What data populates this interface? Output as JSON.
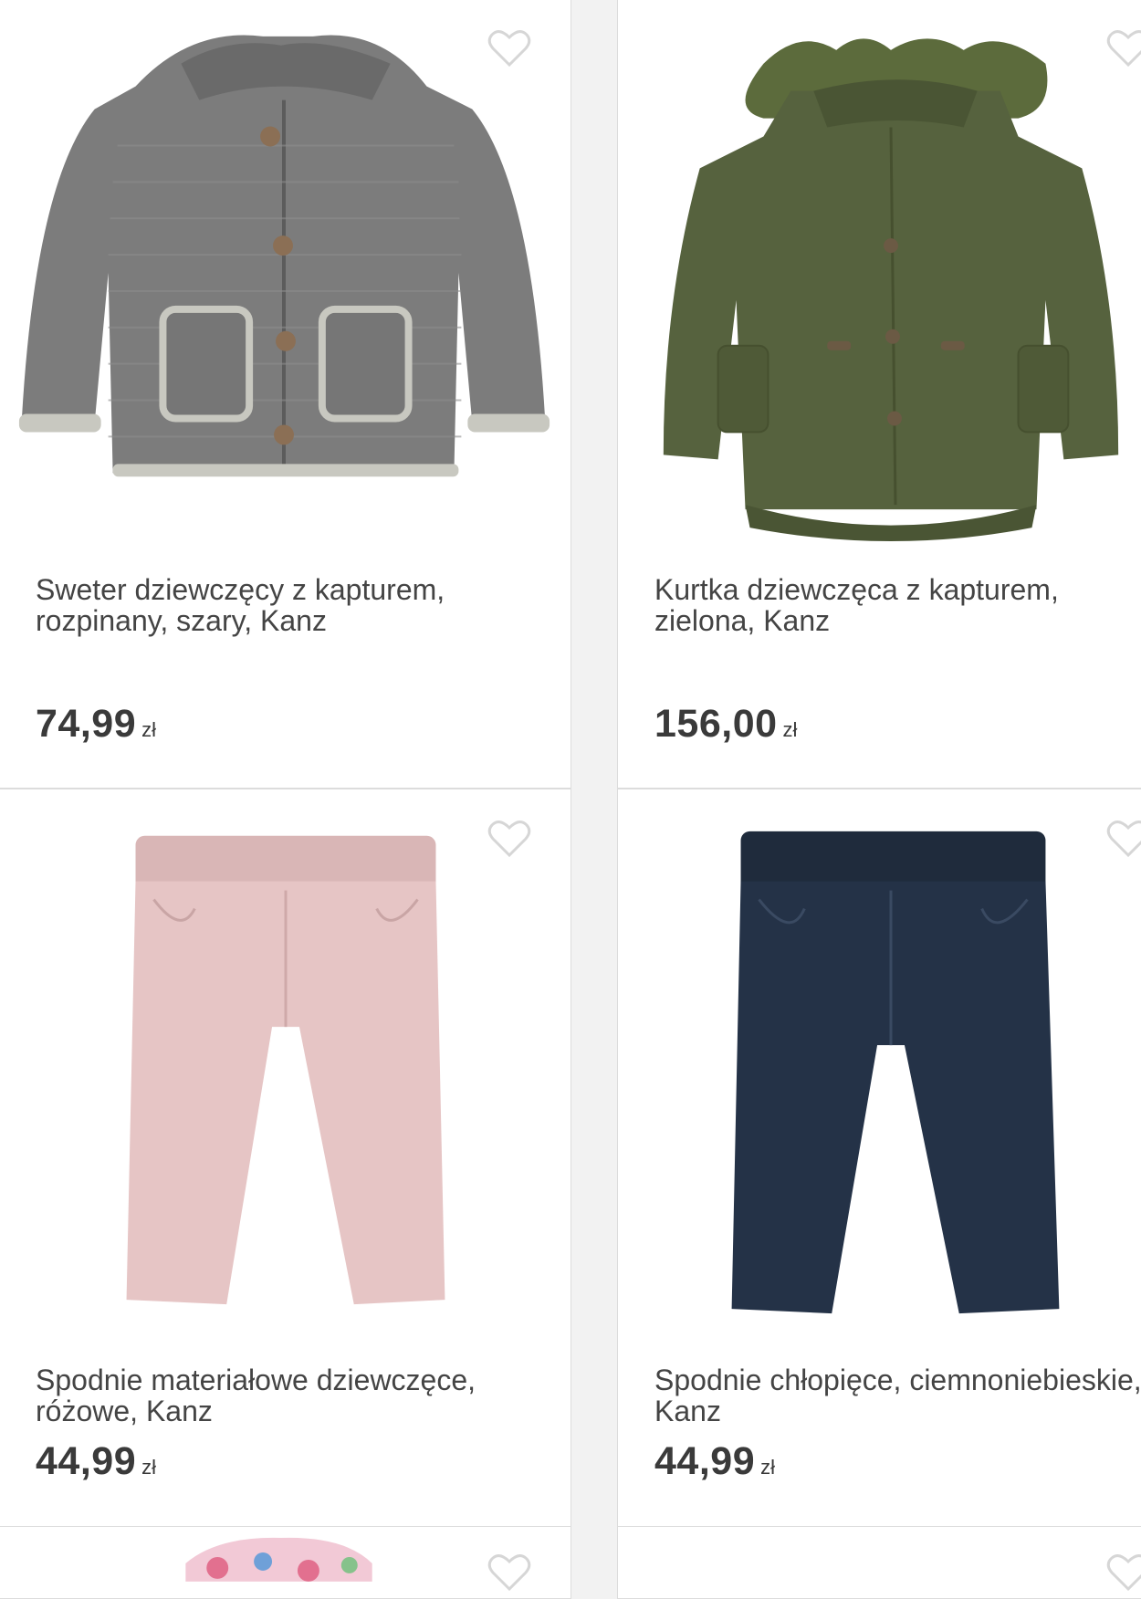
{
  "colors": {
    "background": "#f2f2f2",
    "card": "#ffffff",
    "border": "#dcdcdc",
    "text": "#444444",
    "heart": "#d6d6d6"
  },
  "products": [
    {
      "title": "Sweter dziewczęcy z kapturem, rozpinany, szary, Kanz",
      "price": "74,99",
      "currency": "zł",
      "image": "grey-knit-hooded-sweater",
      "favorite_icon": "heart-outline-icon"
    },
    {
      "title": "Kurtka dziewczęca z kapturem, zielona, Kanz",
      "price": "156,00",
      "currency": "zł",
      "image": "green-parka-jacket-fur-hood",
      "favorite_icon": "heart-outline-icon"
    },
    {
      "title": "Spodnie materiałowe dziewczęce, różowe, Kanz",
      "price": "44,99",
      "currency": "zł",
      "image": "pink-cord-trousers",
      "favorite_icon": "heart-outline-icon"
    },
    {
      "title": "Spodnie chłopięce, ciemnoniebieskie, Kanz",
      "price": "44,99",
      "currency": "zł",
      "image": "navy-cord-trousers",
      "favorite_icon": "heart-outline-icon"
    },
    {
      "title": "",
      "price": "",
      "currency": "",
      "image": "floral-dress",
      "favorite_icon": "heart-outline-icon"
    },
    {
      "title": "",
      "price": "",
      "currency": "",
      "image": "product-image",
      "favorite_icon": "heart-outline-icon"
    }
  ]
}
